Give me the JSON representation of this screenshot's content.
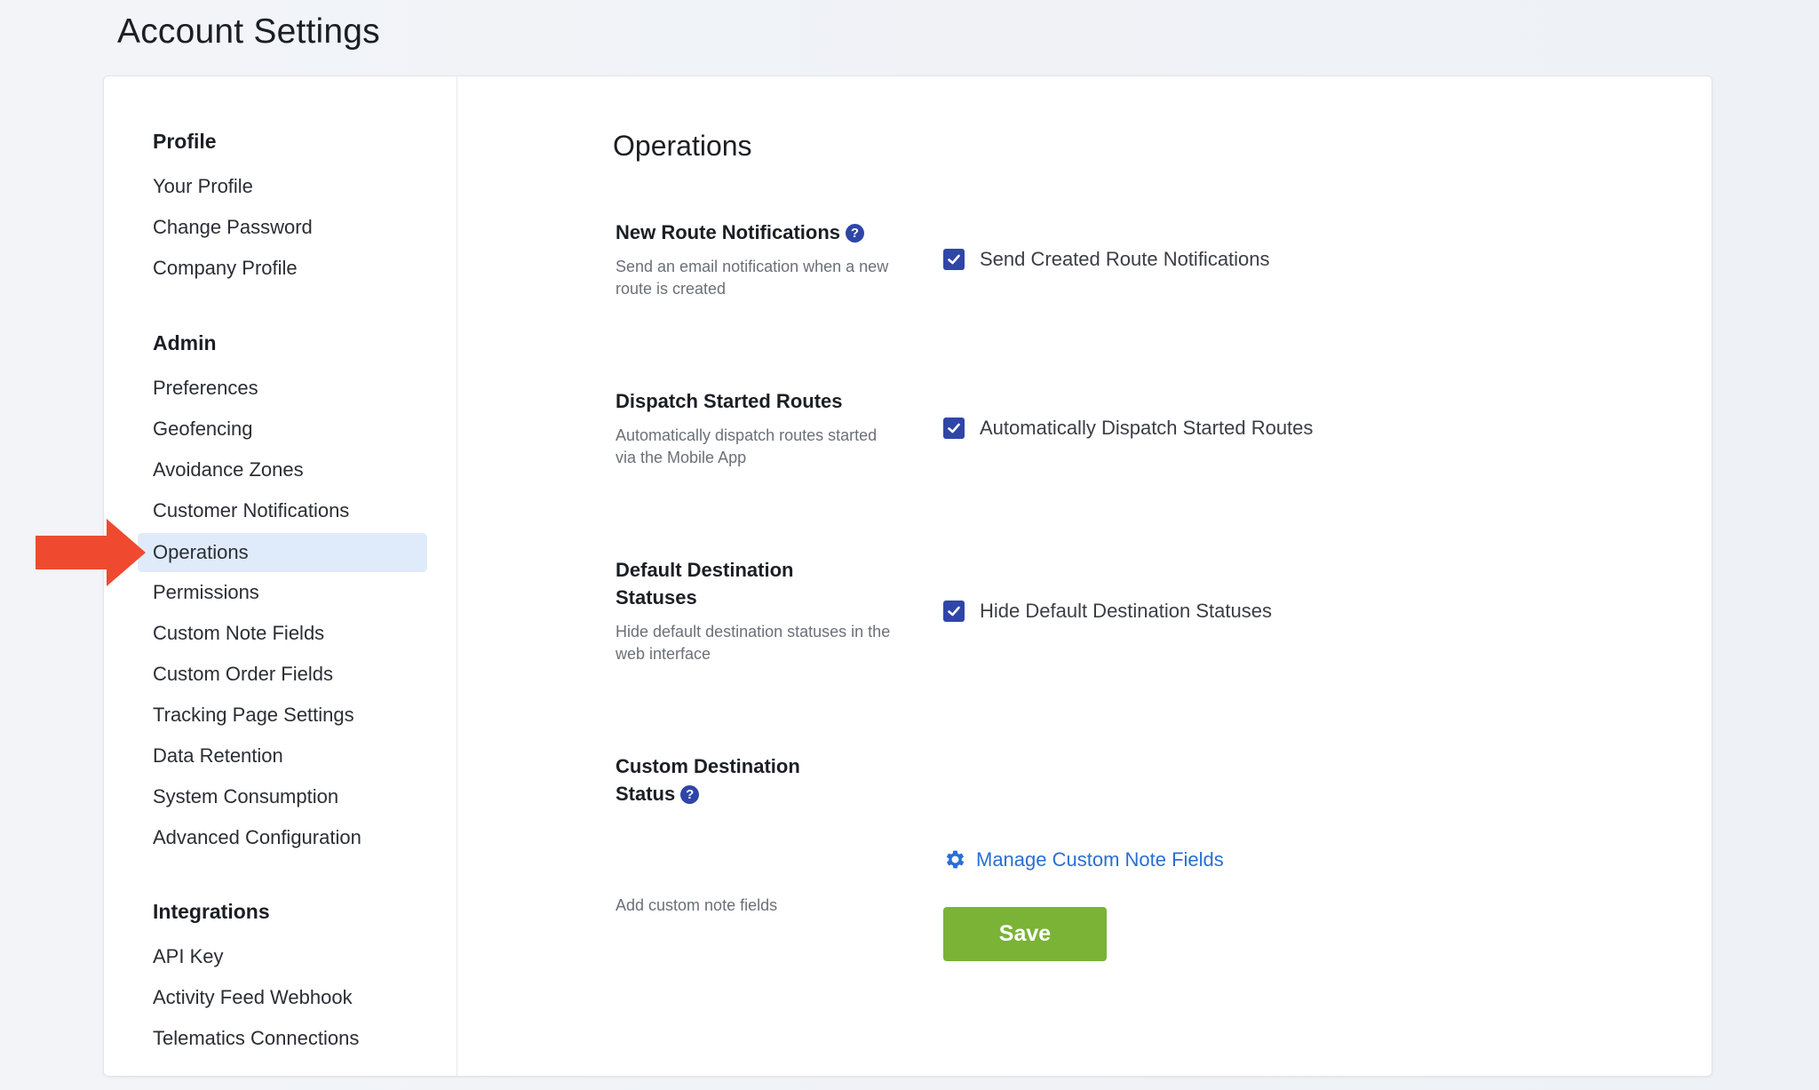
{
  "page_title": "Account Settings",
  "sidebar": {
    "groups": [
      {
        "title": "Profile",
        "items": [
          "Your Profile",
          "Change Password",
          "Company Profile"
        ]
      },
      {
        "title": "Admin",
        "items": [
          "Preferences",
          "Geofencing",
          "Avoidance Zones",
          "Customer Notifications",
          "Operations",
          "Permissions",
          "Custom Note Fields",
          "Custom Order Fields",
          "Tracking Page Settings",
          "Data Retention",
          "System Consumption",
          "Advanced Configuration"
        ]
      },
      {
        "title": "Integrations",
        "items": [
          "API Key",
          "Activity Feed Webhook",
          "Telematics Connections"
        ]
      }
    ],
    "active_item": "Operations"
  },
  "main": {
    "title": "Operations",
    "settings": [
      {
        "label": "New Route Notifications",
        "has_help": true,
        "description": "Send an email notification when a new route is created",
        "checkbox_label": "Send Created Route Notifications",
        "checked": true
      },
      {
        "label": "Dispatch Started Routes",
        "has_help": false,
        "description": "Automatically dispatch routes started via the Mobile App",
        "checkbox_label": "Automatically Dispatch Started Routes",
        "checked": true
      },
      {
        "label": "Default Destination Statuses",
        "has_help": false,
        "description": "Hide default destination statuses in the web interface",
        "checkbox_label": "Hide Default Destination Statuses",
        "checked": true
      },
      {
        "label": "Custom Destination Status",
        "has_help": true,
        "description": "Add custom note fields",
        "link_label": "Manage Custom Note Fields"
      }
    ],
    "help_glyph": "?",
    "save_label": "Save"
  },
  "colors": {
    "accent_blue": "#2f46a8",
    "link_blue": "#2a6ed4",
    "save_green": "#7ab336",
    "active_bg": "#dfebfa",
    "arrow_red": "#ef4a2f"
  }
}
